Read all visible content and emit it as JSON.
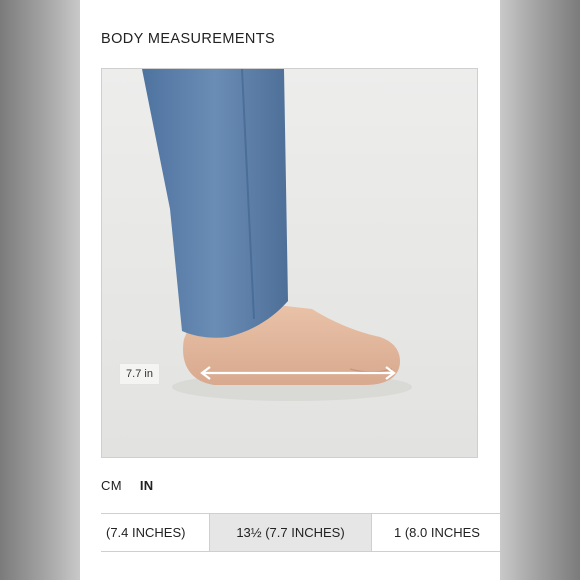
{
  "panel": {
    "title": "BODY MEASUREMENTS"
  },
  "image": {
    "measurement_label": "7.7 in",
    "subject": "foot-with-length-arrow"
  },
  "units": {
    "options": [
      "CM",
      "IN"
    ],
    "selected": "IN"
  },
  "sizes": {
    "items": [
      "(7.4 INCHES)",
      "13½ (7.7 INCHES)",
      "1 (8.0 INCHES"
    ],
    "selected_index": 1
  },
  "colors": {
    "selected_size_bg": "#e6e6e6",
    "denim": "#5a7ea8",
    "skin": "#e3b9a0",
    "background": "#ebebea"
  }
}
